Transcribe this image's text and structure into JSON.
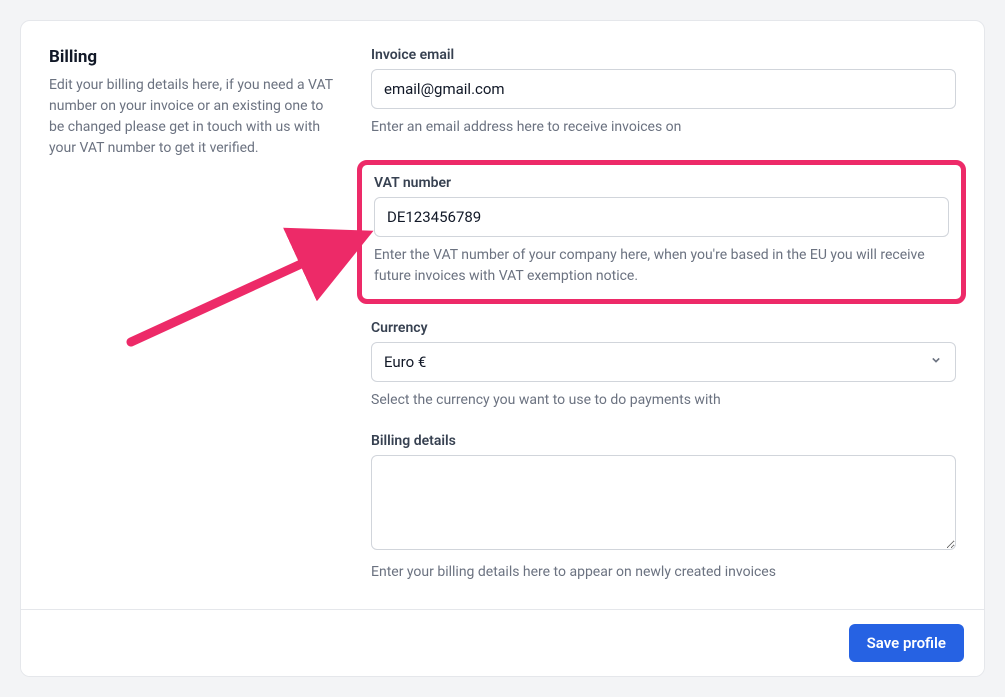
{
  "sidebar": {
    "title": "Billing",
    "description": "Edit your billing details here, if you need a VAT number on your invoice or an existing one to be changed please get in touch with us with your VAT number to get it verified."
  },
  "fields": {
    "invoice_email": {
      "label": "Invoice email",
      "value": "email@gmail.com",
      "helper": "Enter an email address here to receive invoices on"
    },
    "vat_number": {
      "label": "VAT number",
      "value": "DE123456789",
      "helper": "Enter the VAT number of your company here, when you're based in the EU you will receive future invoices with VAT exemption notice."
    },
    "currency": {
      "label": "Currency",
      "value": "Euro €",
      "helper": "Select the currency you want to use to do payments with"
    },
    "billing_details": {
      "label": "Billing details",
      "value": "",
      "helper": "Enter your billing details here to appear on newly created invoices"
    }
  },
  "footer": {
    "save_label": "Save profile"
  },
  "annotation": {
    "highlight_color": "#ed2a68"
  }
}
